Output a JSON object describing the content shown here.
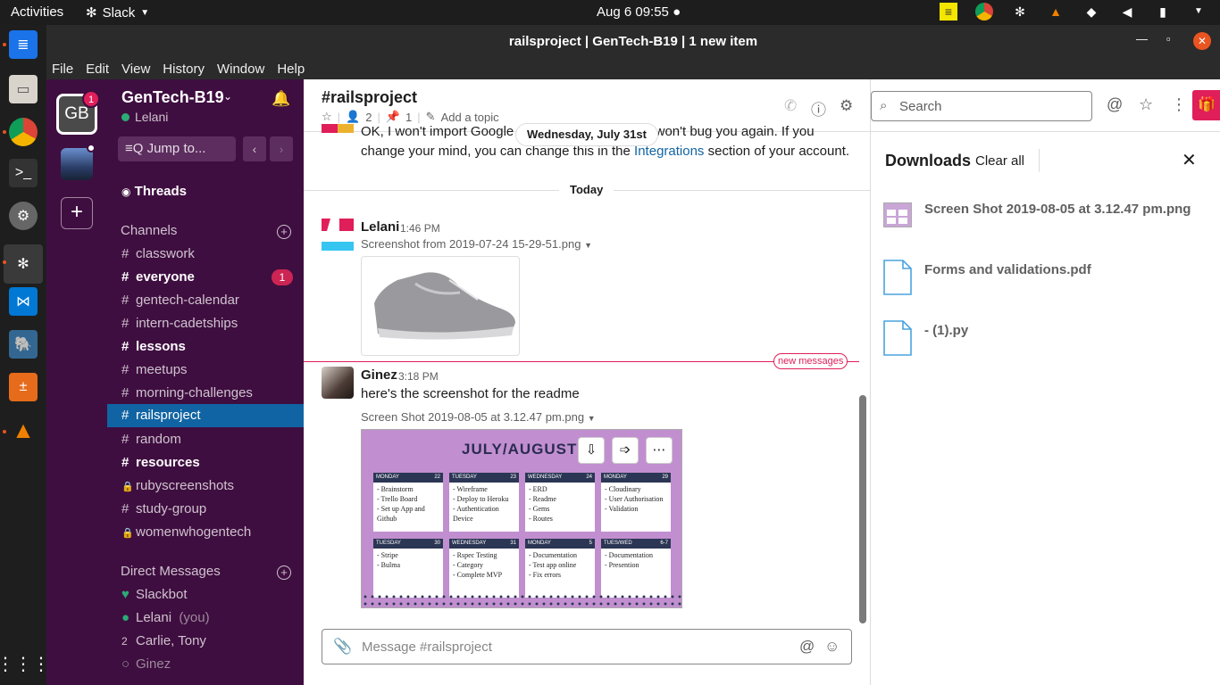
{
  "topbar": {
    "activities": "Activities",
    "app": "Slack",
    "clock": "Aug 6  09:55"
  },
  "window": {
    "title": "railsproject | GenTech-B19 | 1 new item"
  },
  "menu": [
    "File",
    "Edit",
    "View",
    "History",
    "Window",
    "Help"
  ],
  "teams": {
    "initials": "GB",
    "badge": "1"
  },
  "sidebar": {
    "workspace": "GenTech-B19",
    "user": "Lelani",
    "jump": "Jump to...",
    "threads": "Threads",
    "channels_header": "Channels",
    "channels": [
      {
        "prefix": "#",
        "name": "classwork",
        "bold": false
      },
      {
        "prefix": "#",
        "name": "everyone",
        "bold": true,
        "badge": "1"
      },
      {
        "prefix": "#",
        "name": "gentech-calendar",
        "bold": false
      },
      {
        "prefix": "#",
        "name": "intern-cadetships",
        "bold": false
      },
      {
        "prefix": "#",
        "name": "lessons",
        "bold": true
      },
      {
        "prefix": "#",
        "name": "meetups",
        "bold": false
      },
      {
        "prefix": "#",
        "name": "morning-challenges",
        "bold": false
      },
      {
        "prefix": "#",
        "name": "railsproject",
        "bold": false,
        "active": true
      },
      {
        "prefix": "#",
        "name": "random",
        "bold": false
      },
      {
        "prefix": "#",
        "name": "resources",
        "bold": true
      },
      {
        "prefix": "🔒",
        "name": "rubyscreenshots",
        "bold": false
      },
      {
        "prefix": "#",
        "name": "study-group",
        "bold": false
      },
      {
        "prefix": "🔒",
        "name": "womenwhogentech",
        "bold": false
      }
    ],
    "dm_header": "Direct Messages",
    "dms": [
      {
        "prefix": "♥",
        "name": "Slackbot"
      },
      {
        "prefix": "●",
        "name": "Lelani",
        "suffix": "(you)"
      },
      {
        "prefix": "2",
        "name": "Carlie, Tony"
      },
      {
        "prefix": "○",
        "name": "Ginez"
      }
    ]
  },
  "channel": {
    "title": "#railsproject",
    "members": "2",
    "pins": "1",
    "add_topic": "Add a topic"
  },
  "messages": {
    "prev_text_1": "OK, I won't import Google",
    "prev_text_2": "won't bug you again. If you",
    "prev_text_3": "change your mind, you can change this in the",
    "prev_link": "Integrations",
    "prev_text_4": "section of your account.",
    "date_pill": "Wednesday, July 31st",
    "today": "Today",
    "msg1_name": "Lelani",
    "msg1_time": "1:46 PM",
    "msg1_file": "Screenshot from 2019-07-24 15-29-51.png",
    "new_messages": "new messages",
    "msg2_name": "Ginez",
    "msg2_time": "3:18 PM",
    "msg2_text": "here's the screenshot for the readme",
    "msg2_file": "Screen Shot 2019-08-05 at 3.12.47 pm.png"
  },
  "calendar": {
    "title": "JULY/AUGUST",
    "cells": [
      {
        "day": "MONDAY",
        "num": "22",
        "body": "- Brainstorm\n- Trello Board\n- Set up App and\n  Github"
      },
      {
        "day": "TUESDAY",
        "num": "23",
        "body": "- Wireframe\n- Deploy to Heroku\n- Authentication Device"
      },
      {
        "day": "WEDNESDAY",
        "num": "24",
        "body": "- ERD\n- Readme\n- Gems\n- Routes"
      },
      {
        "day": "MONDAY",
        "num": "29",
        "body": "- Cloudinary\n- User Authorisation\n- Validation"
      },
      {
        "day": "TUESDAY",
        "num": "30",
        "body": "- Stripe\n- Bulma"
      },
      {
        "day": "WEDNESDAY",
        "num": "31",
        "body": "- Rspec Testing\n- Category\n- Complete MVP"
      },
      {
        "day": "MONDAY",
        "num": "5",
        "body": "- Documentation\n- Test app online\n- Fix errors"
      },
      {
        "day": "TUES/WED",
        "num": "6-7",
        "body": "- Documentation\n- Presention"
      }
    ]
  },
  "composer": {
    "placeholder": "Message #railsproject"
  },
  "search": {
    "placeholder": "Search"
  },
  "downloads": {
    "title": "Downloads",
    "clear": "Clear all",
    "items": [
      "Screen Shot 2019-08-05 at 3.12.47 pm.png",
      "Forms and validations.pdf",
      "- (1).py"
    ]
  },
  "colors": {
    "sidebar": "#3f0e40",
    "active": "#1164a3",
    "badge": "#cd2553",
    "accent": "#e01e5a"
  }
}
